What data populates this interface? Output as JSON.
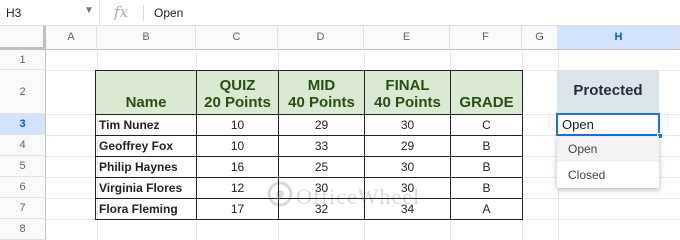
{
  "formula_bar": {
    "name_box": "H3",
    "fx_label": "fx",
    "formula": "Open"
  },
  "columns": [
    "A",
    "B",
    "C",
    "D",
    "E",
    "F",
    "G",
    "H"
  ],
  "selected_column": "H",
  "rows": [
    "1",
    "2",
    "3",
    "4",
    "5",
    "6",
    "7",
    "8"
  ],
  "selected_row": "3",
  "table": {
    "headers": {
      "name": "Name",
      "quiz_line1": "QUIZ",
      "quiz_line2": "20 Points",
      "mid_line1": "MID",
      "mid_line2": "40 Points",
      "final_line1": "FINAL",
      "final_line2": "40 Points",
      "grade": "GRADE"
    },
    "records": [
      {
        "name": "Tim Nunez",
        "quiz": "10",
        "mid": "29",
        "final": "30",
        "grade": "C"
      },
      {
        "name": "Geoffrey Fox",
        "quiz": "10",
        "mid": "33",
        "final": "29",
        "grade": "B"
      },
      {
        "name": "Philip Haynes",
        "quiz": "16",
        "mid": "25",
        "final": "30",
        "grade": "B"
      },
      {
        "name": "Virginia Flores",
        "quiz": "12",
        "mid": "30",
        "final": "30",
        "grade": "B"
      },
      {
        "name": "Flora Fleming",
        "quiz": "17",
        "mid": "32",
        "final": "34",
        "grade": "A"
      }
    ]
  },
  "protected_column": {
    "header": "Protected",
    "active_value": "Open",
    "dropdown_options": [
      "Open",
      "Closed"
    ]
  },
  "watermark": {
    "text": "OfficeWheel"
  },
  "colors": {
    "header_fill": "#d9ead3",
    "header_text": "#274e13",
    "protected_fill": "#dbe5ec",
    "selection_blue": "#1a73e8"
  }
}
